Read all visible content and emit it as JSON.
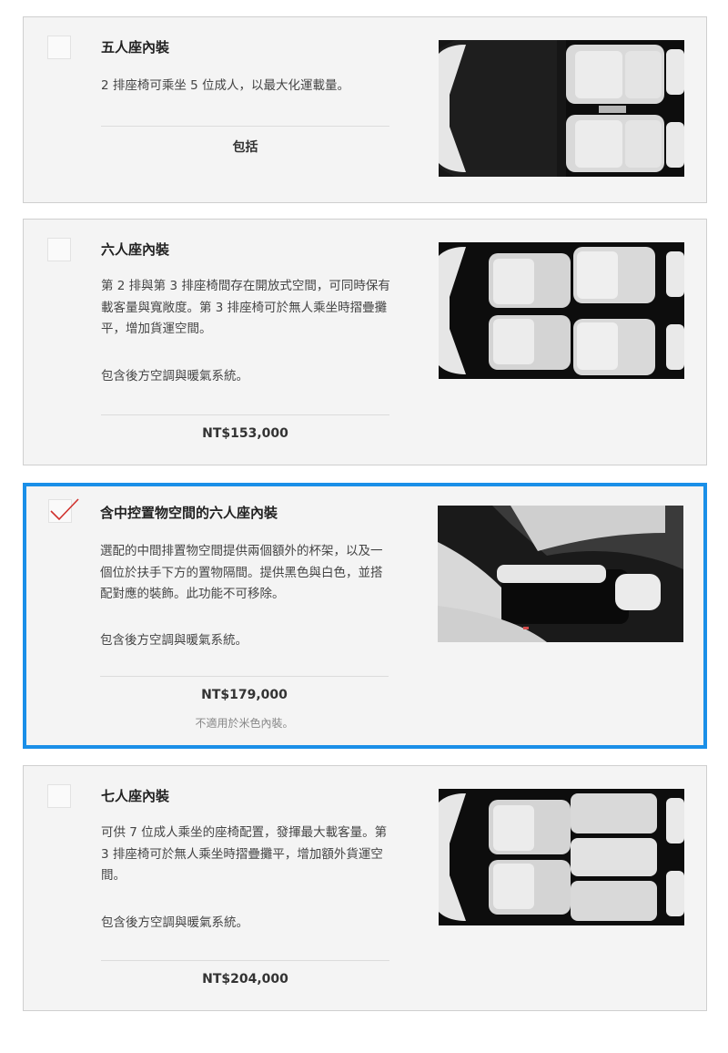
{
  "options": [
    {
      "title": "五人座內裝",
      "desc": "2 排座椅可乘坐 5 位成人，以最大化運載量。",
      "note": "",
      "price": "包括",
      "subnote": "",
      "selected": false,
      "image_icon": "five-seat-interior-image"
    },
    {
      "title": "六人座內裝",
      "desc": "第 2 排與第 3 排座椅間存在開放式空間，可同時保有載客量與寬敞度。第 3 排座椅可於無人乘坐時摺疊攤平，增加貨運空間。",
      "note": "包含後方空調與暖氣系統。",
      "price": "NT$153,000",
      "subnote": "",
      "selected": false,
      "image_icon": "six-seat-interior-image"
    },
    {
      "title": "含中控置物空間的六人座內裝",
      "desc": "選配的中間排置物空間提供兩個額外的杯架，以及一個位於扶手下方的置物隔間。提供黑色與白色，並搭配對應的裝飾。此功能不可移除。",
      "note": "包含後方空調與暖氣系統。",
      "price": "NT$179,000",
      "subnote": "不適用於米色內裝。",
      "selected": true,
      "image_icon": "center-console-image"
    },
    {
      "title": "七人座內裝",
      "desc": "可供 7 位成人乘坐的座椅配置，發揮最大載客量。第 3 排座椅可於無人乘坐時摺疊攤平，增加額外貨運空間。",
      "note": "包含後方空調與暖氣系統。",
      "price": "NT$204,000",
      "subnote": "",
      "selected": false,
      "image_icon": "seven-seat-interior-image"
    }
  ],
  "colors": {
    "selected_border": "#1a8fe8",
    "check": "#d0312d",
    "card_bg": "#f4f4f4"
  }
}
